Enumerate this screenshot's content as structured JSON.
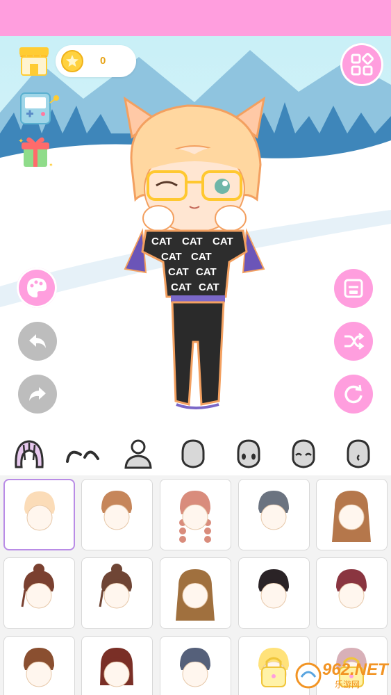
{
  "header": {
    "bar_color": "#ff9ede"
  },
  "wallet": {
    "coins": "0"
  },
  "left_tools": {
    "shop_icon": "shop-icon",
    "game_icon": "handheld-game-icon",
    "gift_icon": "gift-icon"
  },
  "right_tools": {
    "menu_icon": "menu-grid-icon",
    "save_icon": "save-icon",
    "random_icon": "shuffle-icon",
    "reset_icon": "refresh-icon"
  },
  "edit_tools": {
    "palette_icon": "palette-icon",
    "undo_icon": "undo-icon",
    "redo_icon": "redo-icon"
  },
  "character": {
    "shirt_text": "CAT",
    "shirt_color": "#2d2d2d",
    "hair_color": "#ffd7a0",
    "ear_color": "#ffc9a6"
  },
  "categories": [
    {
      "name": "hair-icon",
      "active": true
    },
    {
      "name": "eyebrows-icon",
      "active": false
    },
    {
      "name": "body-icon",
      "active": false
    },
    {
      "name": "head-shape-icon",
      "active": false
    },
    {
      "name": "face-eyes-icon",
      "active": false
    },
    {
      "name": "face-closed-eyes-icon",
      "active": false
    },
    {
      "name": "face-side-icon",
      "active": false
    }
  ],
  "hair_items": [
    {
      "color": "#fbdcb8",
      "style": "short",
      "locked": false,
      "selected": true
    },
    {
      "color": "#c6865a",
      "style": "short",
      "locked": false,
      "selected": false
    },
    {
      "color": "#d98c7c",
      "style": "twin-braids",
      "locked": false,
      "selected": false
    },
    {
      "color": "#6b7380",
      "style": "short",
      "locked": false,
      "selected": false
    },
    {
      "color": "#b5774b",
      "style": "long",
      "locked": false,
      "selected": false
    },
    {
      "color": "#7a4030",
      "style": "bun",
      "locked": false,
      "selected": false
    },
    {
      "color": "#6f4535",
      "style": "bun",
      "locked": false,
      "selected": false
    },
    {
      "color": "#a0703e",
      "style": "long-straight",
      "locked": false,
      "selected": false
    },
    {
      "color": "#2a2326",
      "style": "short",
      "locked": false,
      "selected": false
    },
    {
      "color": "#8a3540",
      "style": "short",
      "locked": false,
      "selected": false
    },
    {
      "color": "#8a4f30",
      "style": "short",
      "locked": false,
      "selected": false
    },
    {
      "color": "#7a2f26",
      "style": "medium",
      "locked": false,
      "selected": false
    },
    {
      "color": "#55607a",
      "style": "short",
      "locked": false,
      "selected": false
    },
    {
      "color": "#ffe27a",
      "style": "short",
      "locked": true,
      "selected": false
    },
    {
      "color": "#d8b0b8",
      "style": "short",
      "locked": true,
      "selected": false
    }
  ],
  "watermark": {
    "main": "962.NET",
    "sub": "乐游网"
  },
  "colors": {
    "pink": "#ff9ede",
    "grey": "#bdbdbd",
    "select_border": "#b98ce6"
  }
}
